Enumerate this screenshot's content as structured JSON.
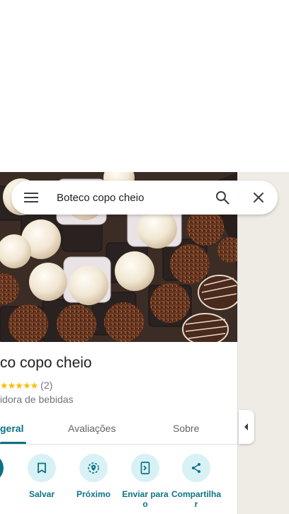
{
  "search": {
    "value": "Boteco copo cheio",
    "menu_icon": "hamburger-menu-icon",
    "search_icon": "search-icon",
    "close_icon": "close-icon"
  },
  "place": {
    "title": "co copo cheio",
    "stars": "★★★★★",
    "review_count": "(2)",
    "category": "idora de bebidas"
  },
  "tabs": [
    {
      "label": "geral",
      "active": true
    },
    {
      "label": "Avaliações",
      "active": false
    },
    {
      "label": "Sobre",
      "active": false
    }
  ],
  "actions": [
    {
      "label": "s",
      "icon": "directions-icon"
    },
    {
      "label": "Salvar",
      "icon": "bookmark-icon"
    },
    {
      "label": "Próximo",
      "icon": "nearby-icon"
    },
    {
      "label": "Enviar para o",
      "icon": "send-to-phone-icon"
    },
    {
      "label": "Compartilha r",
      "icon": "share-icon"
    }
  ],
  "colors": {
    "accent": "#0b7285",
    "action_bg": "#d8f1f5",
    "star": "#fbbc04",
    "map_bg": "#efece6"
  }
}
